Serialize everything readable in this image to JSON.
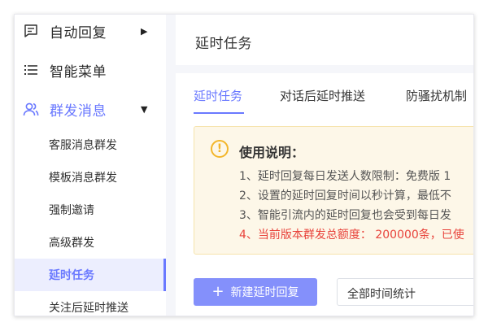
{
  "sidebar": {
    "menus": [
      {
        "label": "自动回复",
        "icon": "message-square-icon",
        "has_arrow": true,
        "arrow": "▶"
      },
      {
        "label": "智能菜单",
        "icon": "list-icon"
      },
      {
        "label": "群发消息",
        "icon": "users-icon",
        "has_arrow": true,
        "arrow": "▼",
        "expanded": true
      }
    ],
    "submenu": [
      {
        "label": "客服消息群发"
      },
      {
        "label": "模板消息群发"
      },
      {
        "label": "强制邀请"
      },
      {
        "label": "高级群发"
      },
      {
        "label": "延时任务",
        "active": true
      },
      {
        "label": "关注后延时推送"
      }
    ]
  },
  "header": {
    "title": "延时任务"
  },
  "tabs": [
    {
      "label": "延时任务",
      "active": true
    },
    {
      "label": "对话后延时推送"
    },
    {
      "label": "防骚扰机制"
    }
  ],
  "notice": {
    "icon": "alert-circle-icon",
    "icon_glyph": "!",
    "title": "使用说明：",
    "lines": [
      "1、延时回复每日发送人数限制：免费版 1",
      "2、设置的延时回复时间以秒计算，最低不",
      "3、智能引流内的延时回复也会受到每日发",
      "4、当前版本群发总额度： 200000条，已使"
    ]
  },
  "actions": {
    "new_button_plus": "+",
    "new_button_label": "新建延时回复",
    "stat_select_value": "全部时间统计"
  },
  "colors": {
    "accent": "#6a79ff",
    "button": "#8490fb",
    "warning_bg": "#fdf7e8",
    "warning_icon": "#f3b62b",
    "danger": "#e8433b"
  }
}
